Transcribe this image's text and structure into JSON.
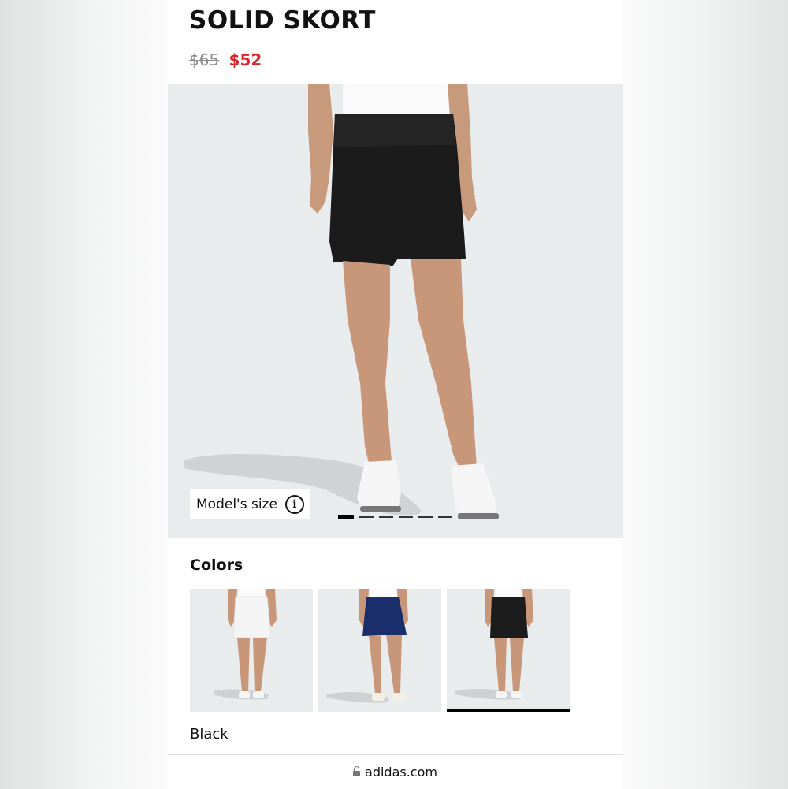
{
  "product": {
    "title": "SOLID SKORT",
    "original_price": "$65",
    "sale_price": "$52"
  },
  "gallery": {
    "model_size_label": "Model's size",
    "info_icon": "i",
    "image_count": 6,
    "active_index": 0
  },
  "colors": {
    "heading": "Colors",
    "selected_name": "Black",
    "options": [
      {
        "skirt_color": "#f4f4f4"
      },
      {
        "skirt_color": "#1a2e6b"
      },
      {
        "skirt_color": "#1c1c1c"
      }
    ],
    "selected_index": 2
  },
  "browser": {
    "url": "adidas.com"
  }
}
